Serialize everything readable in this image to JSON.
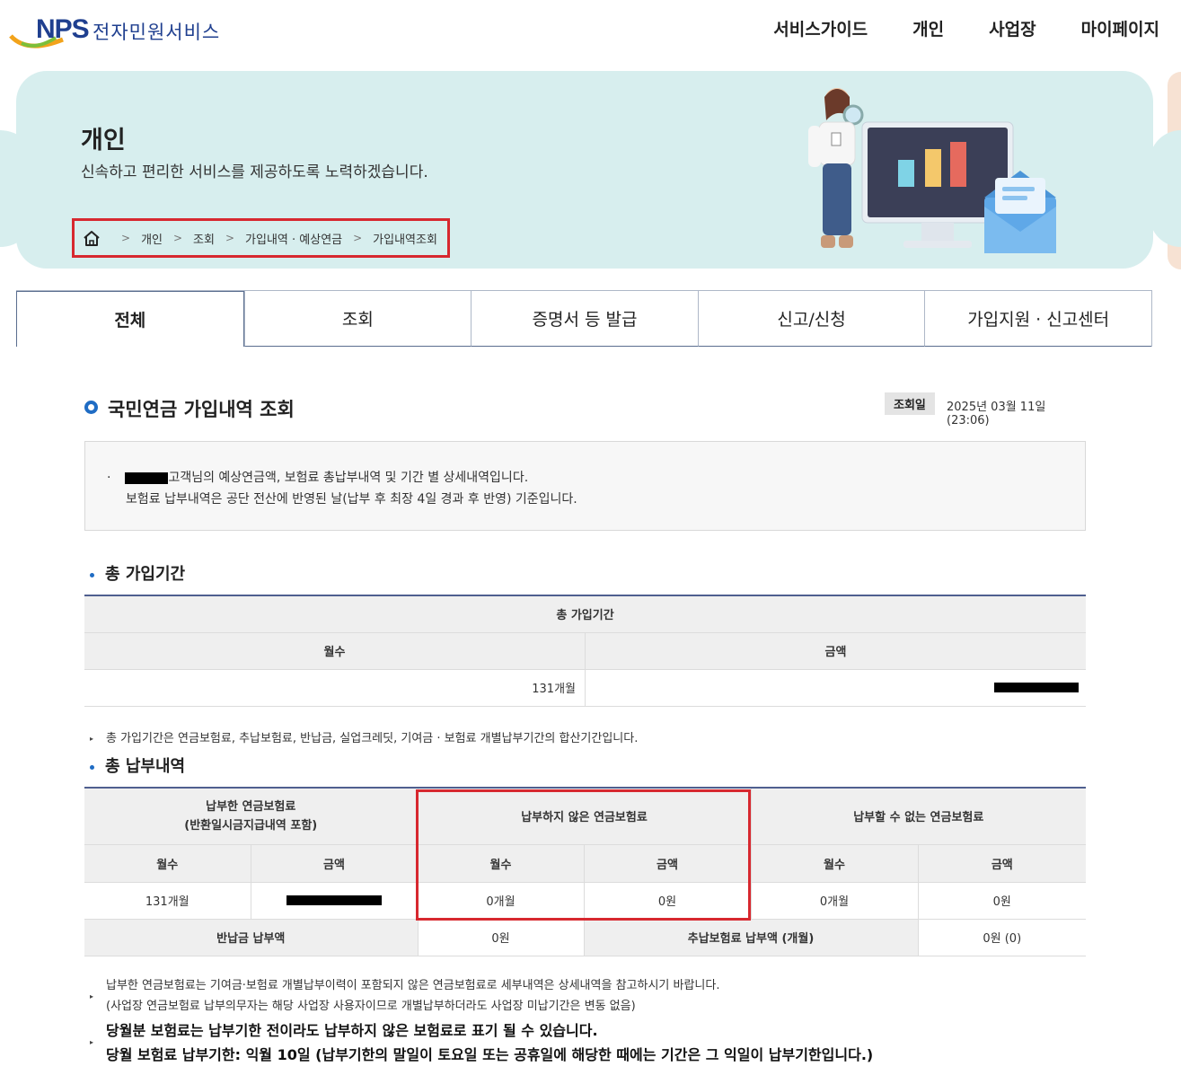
{
  "header": {
    "logo_nps": "NPS",
    "logo_text": "전자민원서비스",
    "nav": [
      "서비스가이드",
      "개인",
      "사업장",
      "마이페이지"
    ]
  },
  "banner": {
    "title": "개인",
    "subtitle": "신속하고 편리한 서비스를 제공하도록 노력하겠습니다.",
    "breadcrumb": [
      "개인",
      "조회",
      "가입내역 · 예상연금",
      "가입내역조회"
    ]
  },
  "tabs": [
    "전체",
    "조회",
    "증명서 등 발급",
    "신고/신청",
    "가입지원 · 신고센터"
  ],
  "content": {
    "title": "국민연금 가입내역 조회",
    "query_date_label": "조회일",
    "query_date": "2025년 03월 11일 (23:06)",
    "info_line1_suffix": "고객님의 예상연금액, 보험료 총납부내역 및 기간 별 상세내역입니다.",
    "info_line2": "보험료 납부내역은 공단 전산에 반영된 날(납부 후 최장 4일 경과 후 반영) 기준입니다."
  },
  "section1": {
    "title": "총 가입기간",
    "table_header": "총 가입기간",
    "col_months": "월수",
    "col_amount": "금액",
    "months_value": "131개월",
    "note": "총 가입기간은 연금보험료, 추납보험료, 반납금, 실업크레딧, 기여금 · 보험료 개별납부기간의 합산기간입니다."
  },
  "section2": {
    "title": "총 납부내역",
    "group1_line1": "납부한 연금보험료",
    "group1_line2": "(반환일시금지급내역 포함)",
    "group2": "납부하지 않은 연금보험료",
    "group3": "납부할 수 없는 연금보험료",
    "col_months": "월수",
    "col_amount": "금액",
    "paid_months": "131개월",
    "unpaid_months": "0개월",
    "unpaid_amount": "0원",
    "cannot_months": "0개월",
    "cannot_amount": "0원",
    "return_label": "반납금 납부액",
    "return_value": "0원",
    "deferred_label": "추납보험료 납부액 (개월)",
    "deferred_value": "0원 (0)"
  },
  "bottom_notes": {
    "note1_line1": "납부한 연금보험료는 기여금·보험료 개별납부이력이 포함되지 않은 연금보험료로 세부내역은 상세내역을 참고하시기 바랍니다.",
    "note1_line2": "(사업장 연금보험료 납부의무자는 해당 사업장 사용자이므로 개별납부하더라도 사업장 미납기간은 변동 없음)",
    "note2_line1": "당월분 보험료는 납부기한 전이라도 납부하지 않은 보험료로 표기 될 수 있습니다.",
    "note2_line2": "당월 보험료 납부기한: 익월 10일 (납부기한의 말일이 토요일 또는 공휴일에 해당한 때에는 기간은 그 익일이 납부기한입니다.)"
  },
  "colors": {
    "brand_blue": "#1f3f8f",
    "accent_blue": "#1f6cc4",
    "banner_bg": "#d7eeee",
    "highlight_red": "#d7282f"
  }
}
